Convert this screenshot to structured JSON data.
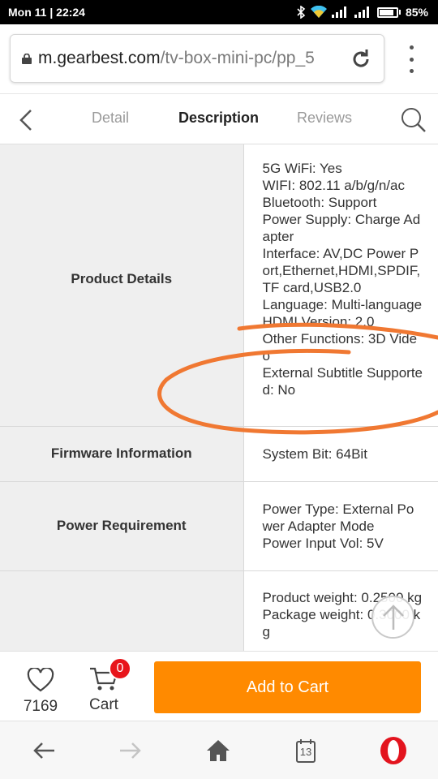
{
  "status_bar": {
    "time": "Mon 11 | 22:24",
    "battery": "85%",
    "battery_level": 0.85
  },
  "browser": {
    "url_domain": "m.gearbest.com",
    "url_path": "/tv-box-mini-pc/pp_5"
  },
  "tabs": [
    {
      "label": "Detail",
      "active": false
    },
    {
      "label": "Description",
      "active": true
    },
    {
      "label": "Reviews",
      "active": false
    }
  ],
  "spec_table": [
    {
      "label": "Product Details",
      "lines": [
        "5G WiFi: Yes",
        "WIFI: 802.11 a/b/g/n/ac",
        "Bluetooth: Support",
        "Power Supply: Charge Adapter",
        "Interface: AV,DC Power Port,Ethernet,HDMI,SPDIF,TF card,USB2.0",
        "Language: Multi-language",
        "HDMI Version: 2.0",
        "Other Functions: 3D Video",
        "External Subtitle Supported: No"
      ]
    },
    {
      "label": "Firmware Information",
      "lines": [
        "System Bit: 64Bit"
      ]
    },
    {
      "label": "Power Requirement",
      "lines": [
        "Power Type: External Power Adapter Mode",
        "Power Input Vol: 5V"
      ]
    },
    {
      "label": "",
      "lines": [
        "Product weight: 0.2500 kg",
        "Package weight: 0.3000 kg"
      ]
    }
  ],
  "cart_bar": {
    "favorites_count": "7169",
    "cart_label": "Cart",
    "cart_badge": "0",
    "add_to_cart_label": "Add to Cart"
  },
  "browser_nav": {
    "tab_count": "13"
  },
  "colors": {
    "accent": "#ff8a00",
    "badge": "#e8151b",
    "annotation": "#f07832"
  }
}
